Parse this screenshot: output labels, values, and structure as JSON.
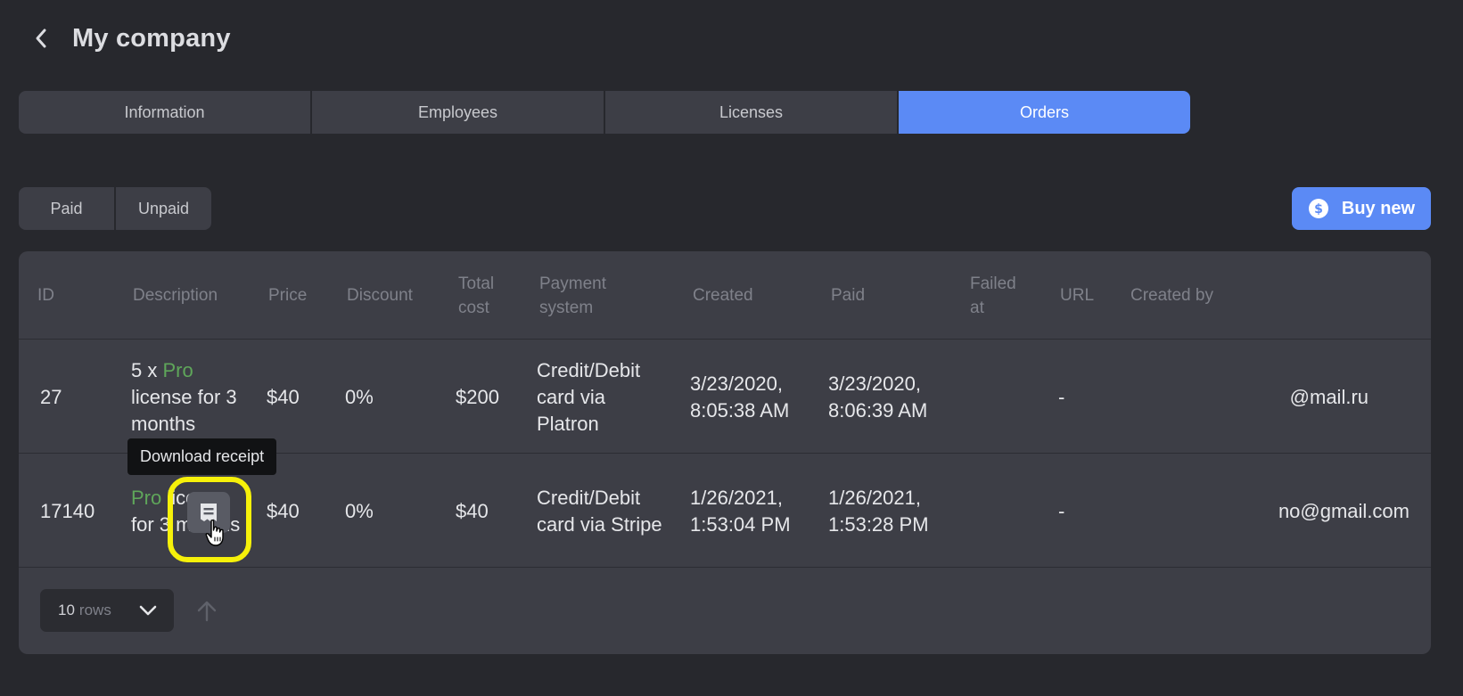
{
  "header": {
    "title": "My company"
  },
  "tabs": [
    {
      "label": "Information",
      "active": false
    },
    {
      "label": "Employees",
      "active": false
    },
    {
      "label": "Licenses",
      "active": false
    },
    {
      "label": "Orders",
      "active": true
    }
  ],
  "filters": [
    {
      "label": "Paid"
    },
    {
      "label": "Unpaid"
    }
  ],
  "buy_button": {
    "label": "Buy new"
  },
  "table": {
    "columns": [
      "ID",
      "Description",
      "Price",
      "Discount",
      "Total cost",
      "Payment system",
      "Created",
      "Paid",
      "Failed at",
      "URL",
      "Created by"
    ],
    "rows": [
      {
        "id": "27",
        "desc_prefix": "5 x ",
        "desc_product": "Pro",
        "desc_suffix": " license for 3 months",
        "price": "$40",
        "discount": "0%",
        "total": "$200",
        "payment": "Credit/Debit card via Platron",
        "created": "3/23/2020, 8:05:38 AM",
        "paid": "3/23/2020, 8:06:39 AM",
        "failed": "",
        "url": "-",
        "created_by": "@mail.ru"
      },
      {
        "id": "17140",
        "desc_prefix": "",
        "desc_product": "Pro",
        "desc_suffix": " license for 3 months",
        "price": "$40",
        "discount": "0%",
        "total": "$40",
        "payment": "Credit/Debit card via Stripe",
        "created": "1/26/2021, 1:53:04 PM",
        "paid": "1/26/2021, 1:53:28 PM",
        "failed": "",
        "url": "-",
        "created_by": "no@gmail.com"
      }
    ]
  },
  "footer": {
    "rows_count": "10",
    "rows_unit": "rows"
  },
  "tooltip": {
    "text": "Download receipt"
  },
  "colors": {
    "accent": "#5b8af5",
    "background": "#27282d",
    "card": "#3d3e46",
    "pro": "#5fa65a",
    "highlight": "#f6f10a"
  },
  "icons": [
    "chevron-left-icon",
    "dollar-coin-icon",
    "receipt-icon",
    "chevron-down-icon",
    "arrow-up-icon",
    "hand-cursor-icon"
  ]
}
